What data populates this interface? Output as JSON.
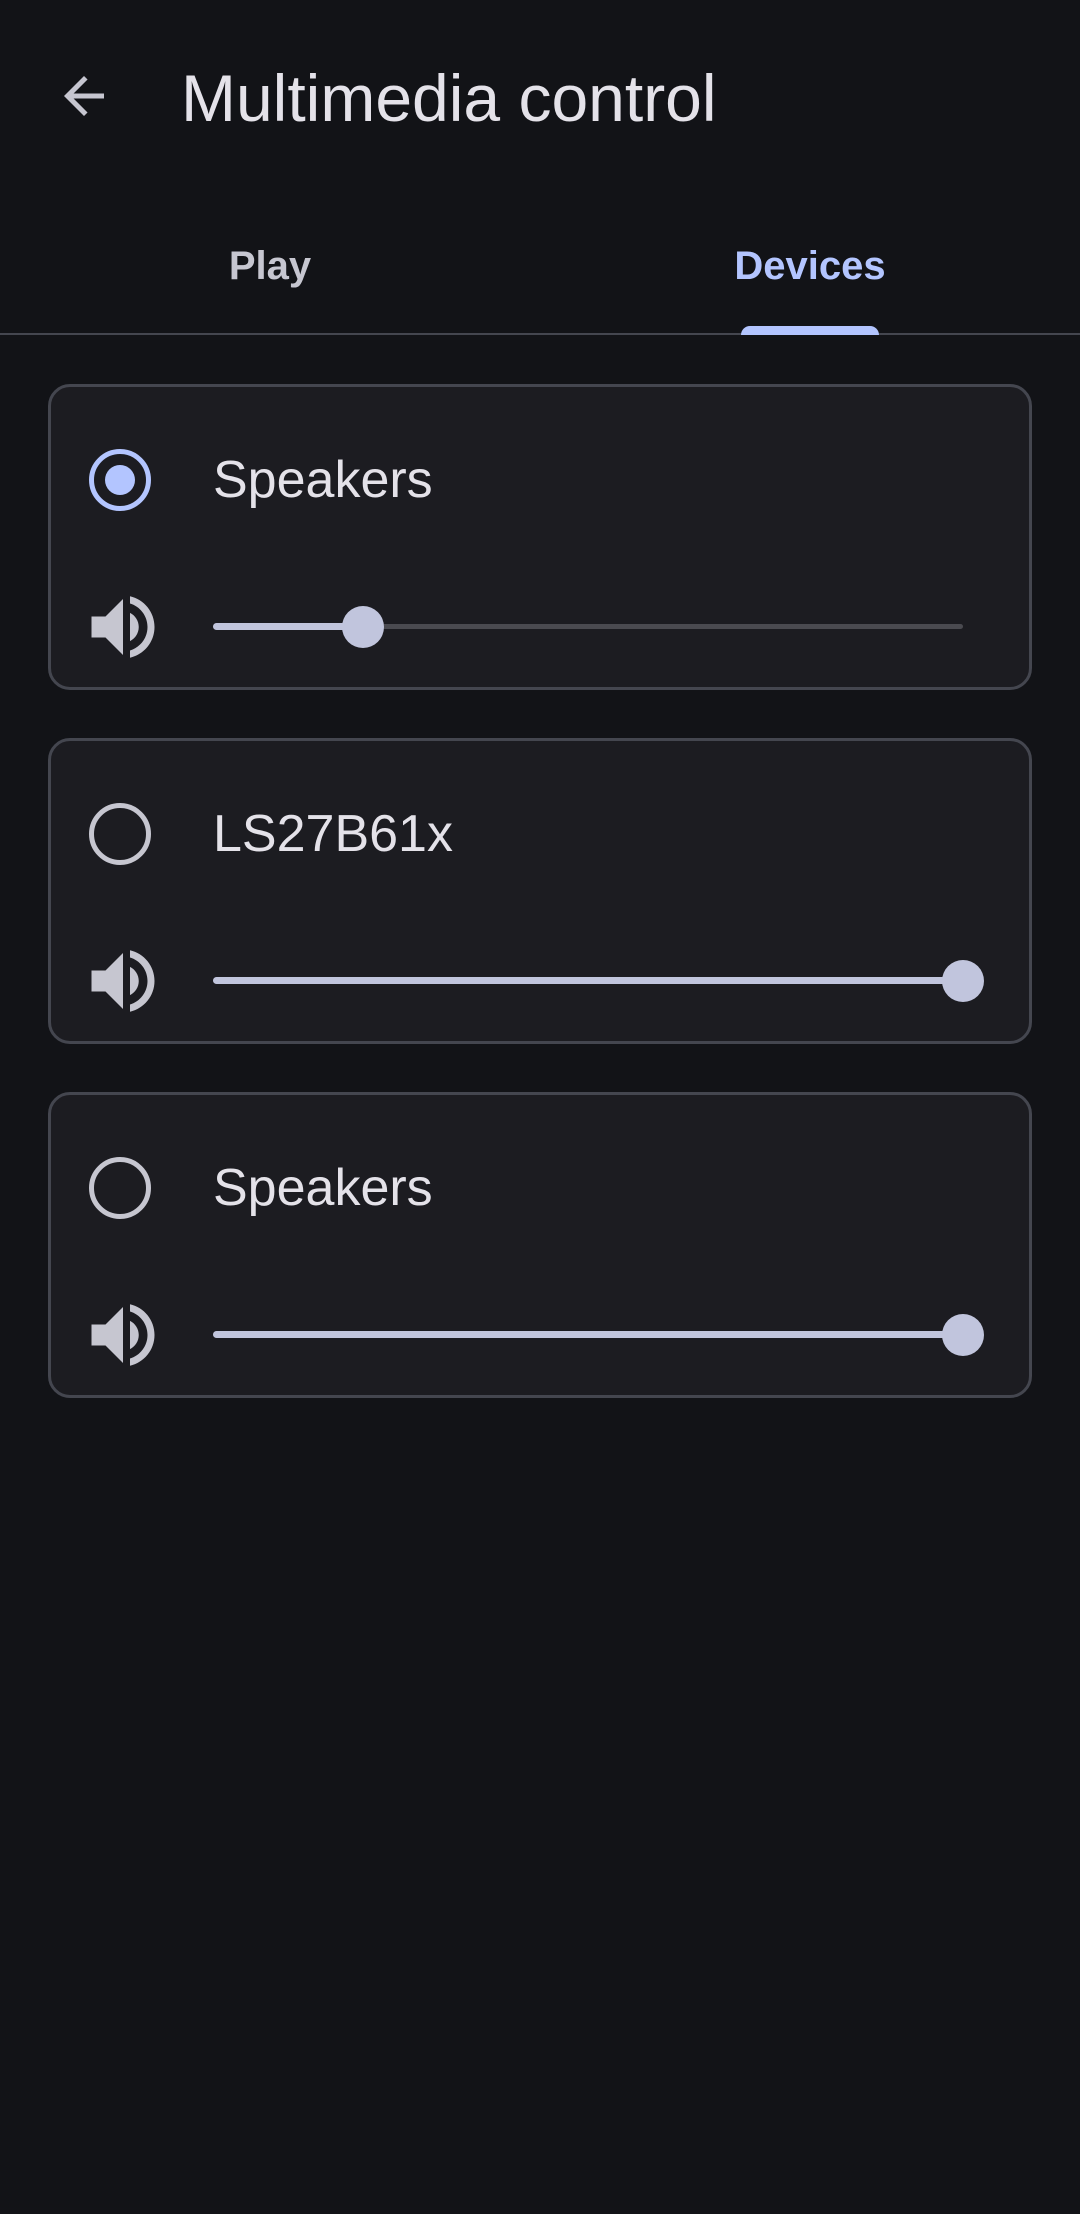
{
  "header": {
    "title": "Multimedia control",
    "back_icon": "arrow-back-icon"
  },
  "tabs": [
    {
      "label": "Play",
      "selected": false
    },
    {
      "label": "Devices",
      "selected": true
    }
  ],
  "devices": [
    {
      "name": "Speakers",
      "selected": true,
      "volume_fraction": 0.2
    },
    {
      "name": "LS27B61x",
      "selected": false,
      "volume_fraction": 1.0
    },
    {
      "name": "Speakers",
      "selected": false,
      "volume_fraction": 1.0
    }
  ],
  "colors": {
    "background": "#121317",
    "card": "#1c1c21",
    "accent": "#b3c5ff",
    "slider": "#c1c5dd"
  }
}
